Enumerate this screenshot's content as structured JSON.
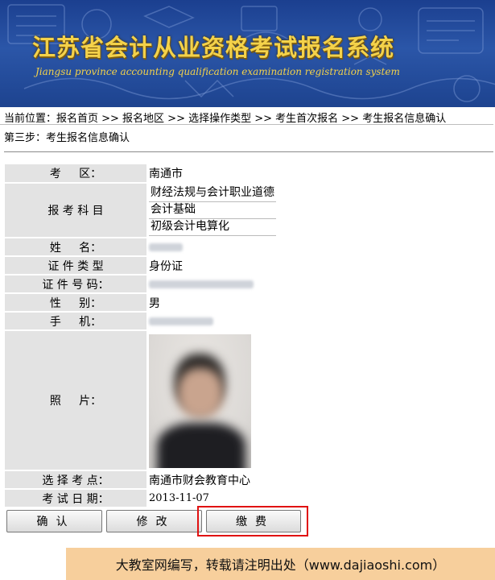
{
  "banner": {
    "title": "江苏省会计从业资格考试报名系统",
    "subtitle": "Jiangsu province accounting qualification examination registration system"
  },
  "breadcrumb": "当前位置：报名首页  >> 报名地区 >> 选择操作类型 >> 考生首次报名 >> 考生报名信息确认",
  "step": "第三步：考生报名信息确认",
  "form": {
    "area": {
      "label": "考     区：",
      "value": "南通市"
    },
    "subjects": {
      "label": "报 考 科 目",
      "items": [
        "财经法规与会计职业道德",
        "会计基础",
        "初级会计电算化"
      ]
    },
    "name": {
      "label": "姓     名："
    },
    "id_type": {
      "label": "证 件 类 型",
      "value": "身份证"
    },
    "id_number": {
      "label": "证 件 号 码："
    },
    "gender": {
      "label": "性     别：",
      "value": "男"
    },
    "phone": {
      "label": "手     机："
    },
    "photo": {
      "label": "照     片："
    },
    "exam_site": {
      "label": "选 择 考 点：",
      "value": "南通市财会教育中心"
    },
    "exam_date": {
      "label": "考 试 日 期：",
      "value": "2013-11-07"
    }
  },
  "buttons": {
    "confirm": "确认",
    "modify": "修改",
    "pay": "缴费"
  },
  "watermark": "大教室网编写，转载请注明出处（www.dajiaoshi.com）",
  "colors": {
    "banner_bg": "#2b56a8",
    "title_gold": "#f4d24a",
    "label_bg": "#e3e3e3",
    "highlight": "#e01010",
    "watermark_bg": "#f7cf9c"
  }
}
